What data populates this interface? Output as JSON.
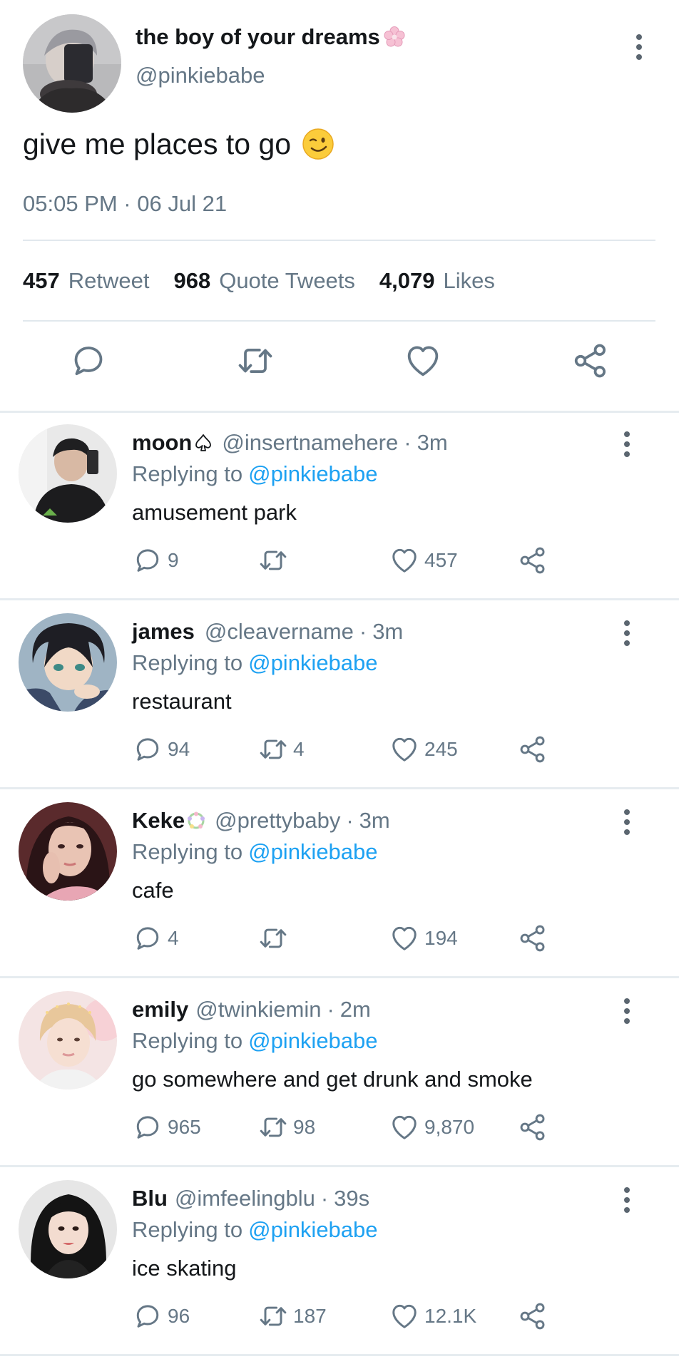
{
  "tweet": {
    "author_name": "the boy of your dreams",
    "author_badge_icon": "cherry-blossom-icon",
    "handle": "@pinkiebabe",
    "text": "give me places to go",
    "text_emoji_icon": "winking-face-icon",
    "timestamp": "05:05 PM · 06 Jul 21",
    "stats": {
      "retweets_count": "457",
      "retweets_label": "Retweet",
      "quotes_count": "968",
      "quotes_label": "Quote Tweets",
      "likes_count": "4,079",
      "likes_label": "Likes"
    },
    "actions": [
      "reply-icon",
      "retweet-icon",
      "like-icon",
      "share-icon"
    ]
  },
  "replies": [
    {
      "name": "moon",
      "name_suffix_icon": "spade-icon",
      "handle": "@insertnamehere",
      "separator": "·",
      "time": "3m",
      "replying_prefix": "Replying to",
      "replying_to": "@pinkiebabe",
      "text": "amusement park",
      "reply_count": "9",
      "retweet_count": "",
      "like_count": "457"
    },
    {
      "name": "james",
      "name_suffix_icon": "",
      "handle": "@cleavername",
      "separator": "·",
      "time": "3m",
      "replying_prefix": "Replying to",
      "replying_to": "@pinkiebabe",
      "text": "restaurant",
      "reply_count": "94",
      "retweet_count": "4",
      "like_count": "245"
    },
    {
      "name": "Keke",
      "name_suffix_icon": "flower-wreath-icon",
      "handle": "@prettybaby",
      "separator": "·",
      "time": "3m",
      "replying_prefix": "Replying to",
      "replying_to": "@pinkiebabe",
      "text": "cafe",
      "reply_count": "4",
      "retweet_count": "",
      "like_count": "194"
    },
    {
      "name": "emily",
      "name_suffix_icon": "",
      "handle": "@twinkiemin",
      "separator": "·",
      "time": "2m",
      "replying_prefix": "Replying to",
      "replying_to": "@pinkiebabe",
      "text": "go somewhere and get drunk and smoke",
      "reply_count": "965",
      "retweet_count": "98",
      "like_count": "9,870"
    },
    {
      "name": "Blu",
      "name_suffix_icon": "",
      "handle": "@imfeelingblu",
      "separator": "·",
      "time": "39s",
      "replying_prefix": "Replying to",
      "replying_to": "@pinkiebabe",
      "text": "ice skating",
      "reply_count": "96",
      "retweet_count": "187",
      "like_count": "12.1K"
    }
  ],
  "colors": {
    "text_primary": "#14171a",
    "text_secondary": "#657786",
    "link": "#1da1f2",
    "divider": "#e1e8ed",
    "icon": "#657786"
  }
}
